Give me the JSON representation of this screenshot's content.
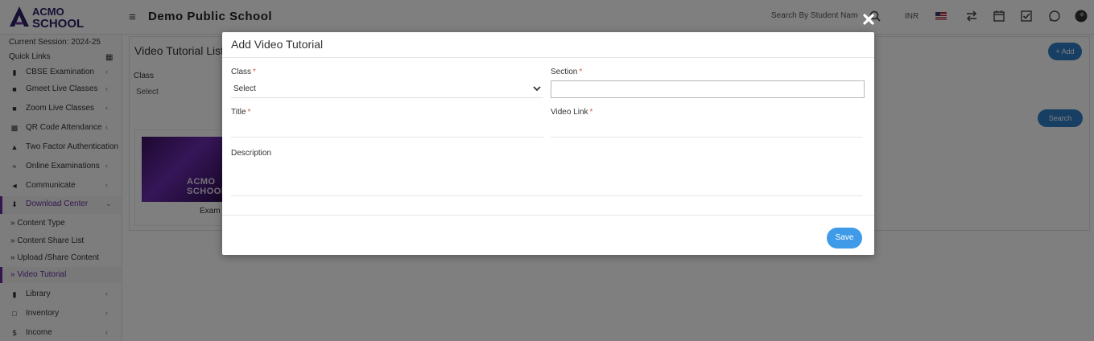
{
  "header": {
    "logo_top": "ACMO",
    "logo_bottom": "SCHOOL",
    "school_name": "Demo Public School",
    "search_placeholder": "Search By Student Name",
    "currency": "INR"
  },
  "sidebar": {
    "session": "Current Session: 2024-25",
    "quick_links": "Quick Links",
    "items": [
      {
        "label": "CBSE Examination",
        "icon": "book-icon"
      },
      {
        "label": "Gmeet Live Classes",
        "icon": "video-icon"
      },
      {
        "label": "Zoom Live Classes",
        "icon": "video-icon"
      },
      {
        "label": "QR Code Attendance",
        "icon": "qrcode-icon"
      },
      {
        "label": "Two Factor Authentication",
        "icon": "lock-icon"
      },
      {
        "label": "Online Examinations",
        "icon": "rss-icon"
      },
      {
        "label": "Communicate",
        "icon": "bullhorn-icon"
      },
      {
        "label": "Download Center",
        "icon": "download-icon"
      },
      {
        "label": "Library",
        "icon": "book-icon"
      },
      {
        "label": "Inventory",
        "icon": "inventory-icon"
      },
      {
        "label": "Income",
        "icon": "dollar-icon"
      }
    ],
    "subitems": [
      {
        "label": "» Content Type"
      },
      {
        "label": "» Content Share List"
      },
      {
        "label": "» Upload /Share Content"
      },
      {
        "label": "» Video Tutorial"
      }
    ]
  },
  "main": {
    "title": "Video Tutorial List",
    "filter_label": "Class",
    "filter_value": "Select",
    "add_label": "+ Add",
    "search_label": "Search",
    "card_caption": "Exam",
    "thumb_logo": "ACMO SCHOOL"
  },
  "modal": {
    "title": "Add Video Tutorial",
    "class_label": "Class",
    "class_value": "Select",
    "section_label": "Section",
    "section_value": "",
    "title_label": "Title",
    "video_link_label": "Video Link",
    "description_label": "Description",
    "required_mark": "*",
    "save_label": "Save"
  },
  "colors": {
    "brand": "#6b2fa1",
    "primary_button": "#3f9be8",
    "overlay": "rgba(0,0,0,0.5)"
  }
}
